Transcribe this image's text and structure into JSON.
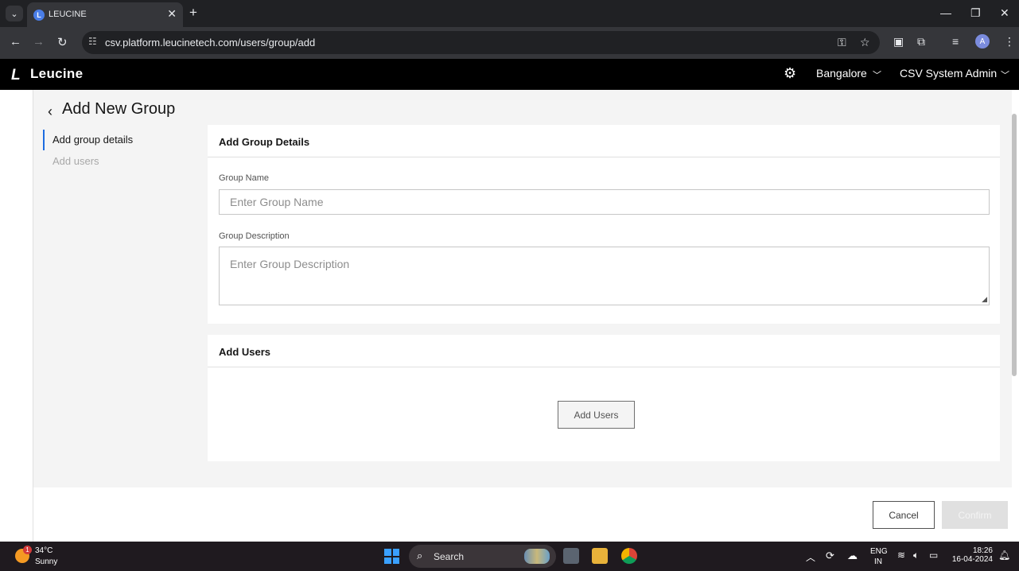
{
  "browser": {
    "tab_title": "LEUCINE",
    "url": "csv.platform.leucinetech.com/users/group/add",
    "profile_initial": "A"
  },
  "app": {
    "logo_text": "Leucine",
    "facility": "Bangalore",
    "user": "CSV System Admin"
  },
  "page": {
    "title": "Add New Group",
    "steps": [
      "Add group details",
      "Add users"
    ]
  },
  "group_details": {
    "heading": "Add Group Details",
    "name_label": "Group Name",
    "name_placeholder": "Enter Group Name",
    "desc_label": "Group Description",
    "desc_placeholder": "Enter Group Description"
  },
  "add_users": {
    "heading": "Add Users",
    "button": "Add Users"
  },
  "footer": {
    "cancel": "Cancel",
    "confirm": "Confirm"
  },
  "taskbar": {
    "temperature": "34°C",
    "condition": "Sunny",
    "weather_badge": "1",
    "search": "Search",
    "lang1": "ENG",
    "lang2": "IN",
    "time": "18:26",
    "date": "16-04-2024"
  }
}
